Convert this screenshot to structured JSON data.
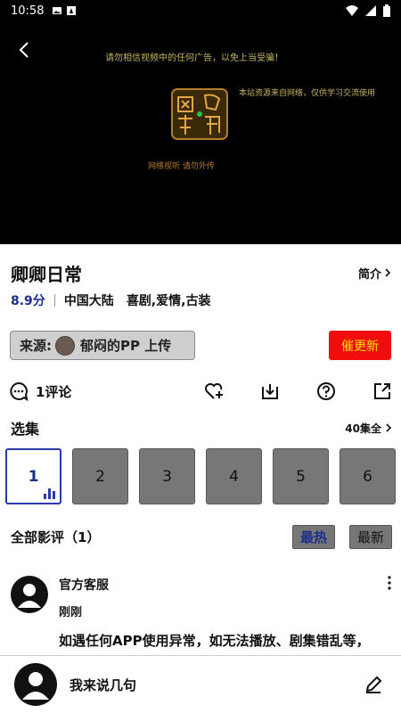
{
  "status_bar": {
    "time": "10:58"
  },
  "player": {
    "notice_top": "请勿相信视频中的任何广告，以免上当受骗！",
    "notice_right": "本站资源来自网络，仅供学习交流使用",
    "notice_bottom": "网络视听 请勿外传"
  },
  "show": {
    "title": "卿卿日常",
    "intro_label": "简介",
    "score": "8.9分",
    "region": "中国大陆",
    "genres": "喜剧,爱情,古装"
  },
  "source": {
    "prefix": "来源:",
    "uploader": "郁闷的PP 上传",
    "update_label": "催更新"
  },
  "actions": {
    "comment_count": "1评论"
  },
  "episodes": {
    "label": "选集",
    "all_label": "40集全",
    "items": [
      "1",
      "2",
      "3",
      "4",
      "5",
      "6"
    ],
    "selected": "1"
  },
  "reviews": {
    "label": "全部影评（1）",
    "sort_hot": "最热",
    "sort_new": "最新",
    "items": [
      {
        "name": "官方客服",
        "time": "刚刚",
        "text": "如遇任何APP使用异常，如无法播放、剧集错乱等，"
      }
    ]
  },
  "composer": {
    "placeholder": "我来说几句"
  },
  "colors": {
    "accent": "#1b2f8f",
    "update_button": "#f20d0d",
    "update_text": "#ffe100"
  }
}
